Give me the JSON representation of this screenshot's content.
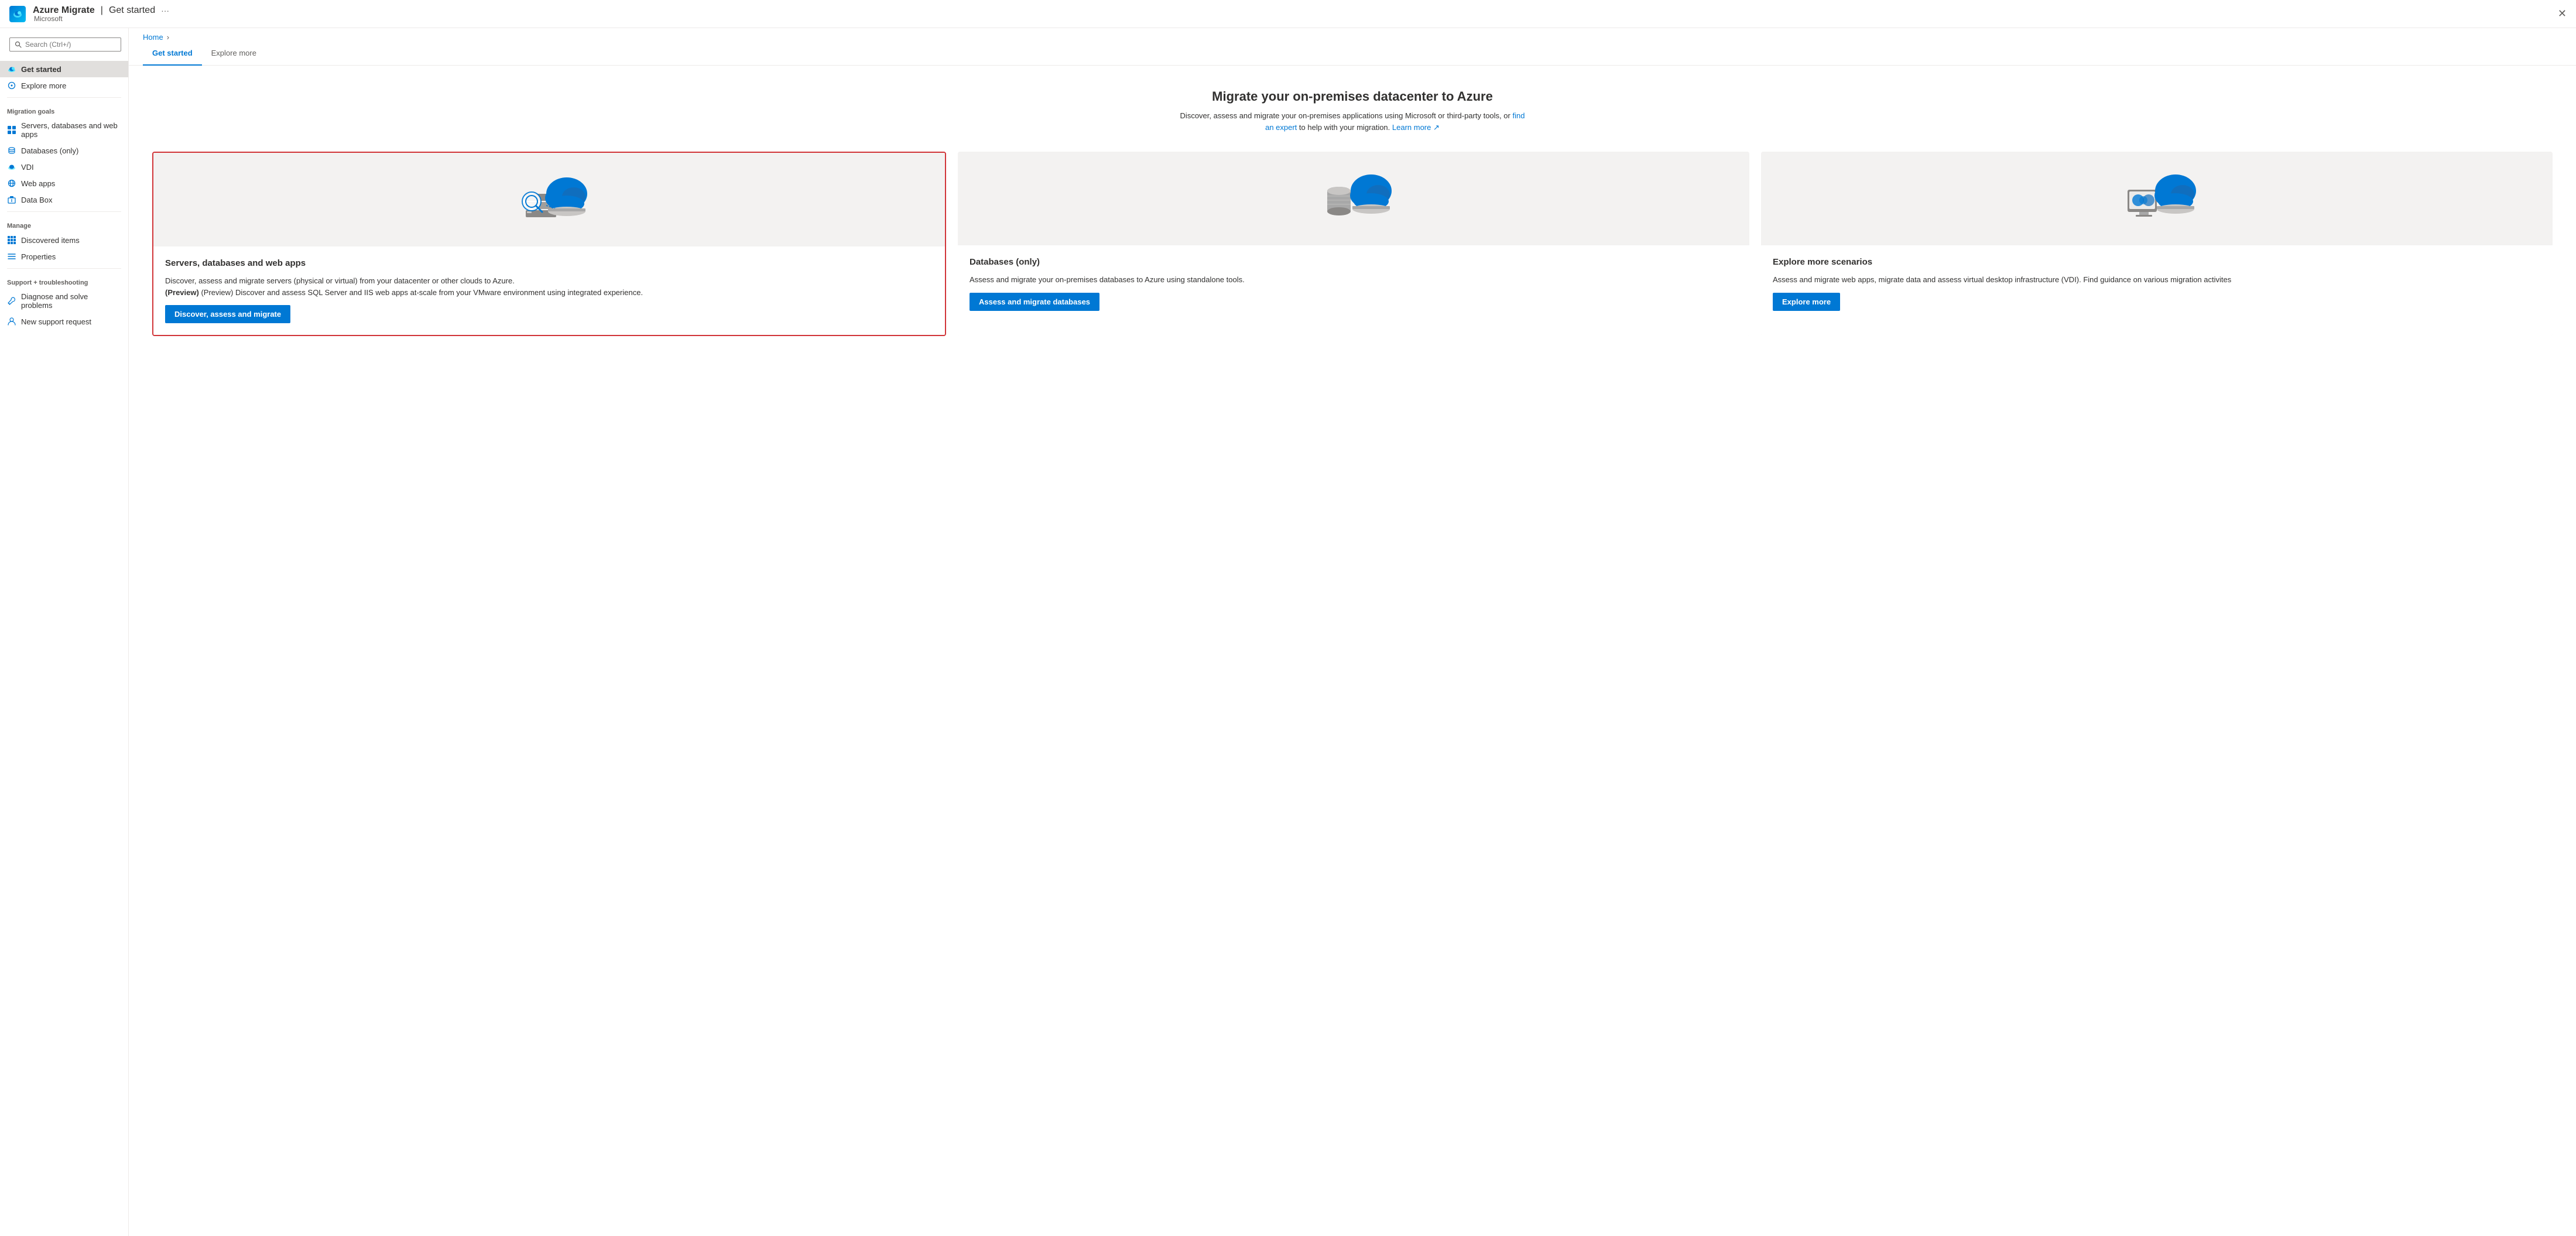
{
  "topbar": {
    "logo_alt": "Azure Migrate logo",
    "title": "Azure Migrate",
    "separator": "|",
    "subtitle": "Get started",
    "more_icon": "···",
    "close_icon": "✕",
    "org_name": "Microsoft"
  },
  "sidebar": {
    "search_placeholder": "Search (Ctrl+/)",
    "nav_items": [
      {
        "id": "get-started",
        "label": "Get started",
        "active": true,
        "icon": "cloud-icon"
      },
      {
        "id": "explore-more",
        "label": "Explore more",
        "active": false,
        "icon": "compass-icon"
      }
    ],
    "sections": [
      {
        "title": "Migration goals",
        "items": [
          {
            "id": "servers-databases-webapps",
            "label": "Servers, databases and web apps",
            "icon": "grid-icon"
          },
          {
            "id": "databases-only",
            "label": "Databases (only)",
            "icon": "db-icon"
          },
          {
            "id": "vdi",
            "label": "VDI",
            "icon": "cloud-small-icon"
          },
          {
            "id": "web-apps",
            "label": "Web apps",
            "icon": "globe-icon"
          },
          {
            "id": "data-box",
            "label": "Data Box",
            "icon": "box-icon"
          }
        ]
      },
      {
        "title": "Manage",
        "items": [
          {
            "id": "discovered-items",
            "label": "Discovered items",
            "icon": "grid2-icon"
          },
          {
            "id": "properties",
            "label": "Properties",
            "icon": "bars-icon"
          }
        ]
      },
      {
        "title": "Support + troubleshooting",
        "items": [
          {
            "id": "diagnose-solve",
            "label": "Diagnose and solve problems",
            "icon": "wrench-icon"
          },
          {
            "id": "new-support-request",
            "label": "New support request",
            "icon": "person-icon"
          }
        ]
      }
    ]
  },
  "breadcrumb": {
    "home": "Home",
    "chevron": "›"
  },
  "tabs": [
    {
      "id": "get-started",
      "label": "Get started",
      "active": true
    },
    {
      "id": "explore-more",
      "label": "Explore more",
      "active": false
    }
  ],
  "hero": {
    "title": "Migrate your on-premises datacenter to Azure",
    "description": "Discover, assess and migrate your on-premises applications using Microsoft or third-party tools, or",
    "link1_text": "find an expert",
    "link1_suffix": "to help with your migration.",
    "link2_text": "Learn more",
    "link2_icon": "↗"
  },
  "cards": [
    {
      "id": "servers-card",
      "highlighted": true,
      "title": "Servers, databases and web apps",
      "description_main": "Discover, assess and migrate servers (physical or virtual) from your datacenter or other clouds to Azure.",
      "description_preview": "(Preview) Discover and assess SQL Server and IIS web apps at-scale from your VMware environment using integrated experience.",
      "button_label": "Discover, assess and migrate",
      "button_id": "discover-assess-migrate-btn"
    },
    {
      "id": "databases-card",
      "highlighted": false,
      "title": "Databases (only)",
      "description_main": "Assess and migrate your on-premises databases to Azure using standalone tools.",
      "button_label": "Assess and migrate databases",
      "button_id": "assess-migrate-databases-btn"
    },
    {
      "id": "explore-scenarios-card",
      "highlighted": false,
      "title": "Explore more scenarios",
      "description_main": "Assess and migrate web apps, migrate data and assess virtual desktop infrastructure (VDI). Find guidance on various migration activites",
      "button_label": "Explore more",
      "button_id": "explore-more-btn"
    }
  ],
  "colors": {
    "azure_blue": "#0078d4",
    "highlight_red": "#d13438",
    "text_primary": "#323130",
    "text_secondary": "#605e5c",
    "bg_light": "#f3f2f1",
    "bg_card": "#f8f8f8"
  }
}
